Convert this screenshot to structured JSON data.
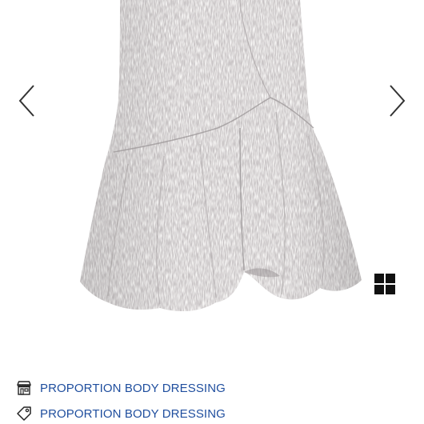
{
  "gallery": {
    "image_alt": "grey tweed mermaid skirt product photo",
    "prev_icon": "chevron-left-icon",
    "next_icon": "chevron-right-icon",
    "grid_icon": "grid-view-icon"
  },
  "brand_links": [
    {
      "icon": "store-icon",
      "label": "PROPORTION BODY DRESSING"
    },
    {
      "icon": "tag-icon",
      "label": "PROPORTION BODY DRESSING"
    }
  ],
  "colors": {
    "link": "#1f4e9e",
    "fabric": "#c9c5c6",
    "icon": "#222222"
  }
}
